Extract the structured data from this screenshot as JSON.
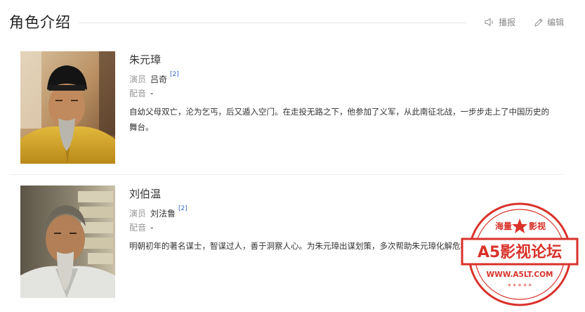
{
  "header": {
    "title": "角色介绍",
    "play_label": "播报",
    "edit_label": "编辑"
  },
  "roles": [
    {
      "name": "朱元璋",
      "actor_label": "演员",
      "actor": "吕奇",
      "actor_ref": "[2]",
      "dub_label": "配音",
      "dub": "-",
      "description": "自幼父母双亡，沦为乞丐，后又遁入空门。在走投无路之下，他参加了义军，从此南征北战，一步步走上了中国历史的舞台。"
    },
    {
      "name": "刘伯温",
      "actor_label": "演员",
      "actor": "刘法鲁",
      "actor_ref": "[2]",
      "dub_label": "配音",
      "dub": "-",
      "description": "明朝初年的著名谋士，智谋过人，善于洞察人心。为朱元璋出谋划策，多次帮助朱元璋化解危机。"
    }
  ],
  "watermark": {
    "top_left": "海量",
    "top_right": "影视",
    "banner": "A5影视论坛",
    "url": "WWW.A5LT.COM"
  },
  "colors": {
    "stamp_red": "#d9322b",
    "ref_blue": "#3366cc"
  }
}
